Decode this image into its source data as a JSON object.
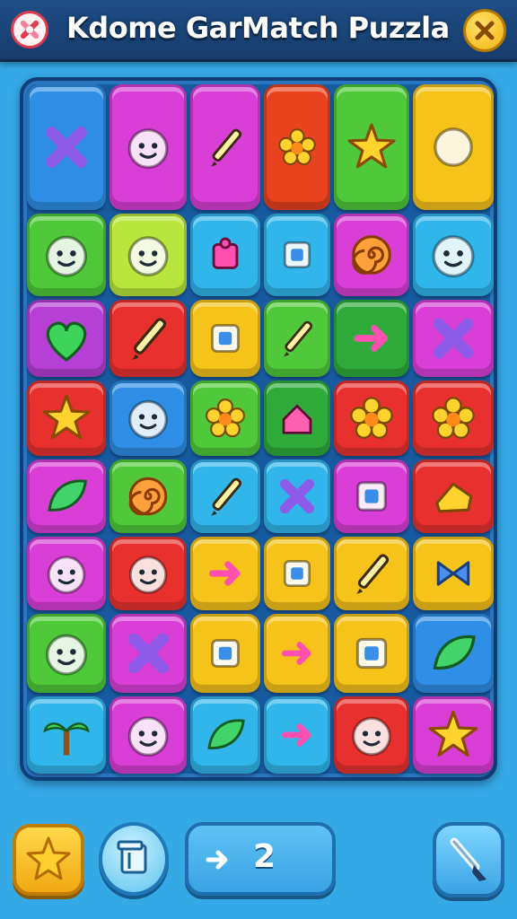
{
  "header": {
    "title": "Kdome GarMatch Puzzla",
    "logo_icon": "crossed-tools-icon",
    "close_icon": "close-x-icon"
  },
  "colors": {
    "header": "#1f4e86",
    "background": "#35a8e6",
    "board": "#185aa0",
    "accent_yellow": "#f6c31b"
  },
  "board": {
    "rows": 8,
    "cols": 6,
    "tiles": [
      [
        {
          "color": "#2f8fe6",
          "icon": "crossed-tools-and-panel-icon"
        },
        {
          "color": "#d93fd6",
          "icon": "cheese-and-bear-face-icon"
        },
        {
          "color": "#d93fd6",
          "icon": "pencil-and-guitar-icon"
        },
        {
          "color": "#e8421f",
          "icon": "gear-and-tower-icon"
        },
        {
          "color": "#4fc93a",
          "icon": "cloud-and-star-icon"
        },
        {
          "color": "#f6c31b",
          "icon": "swirl-and-bandage-icon"
        }
      ],
      [
        {
          "color": "#4fc93a",
          "icon": "koala-face-icon"
        },
        {
          "color": "#b9e63c",
          "icon": "blob-with-hat-icon"
        },
        {
          "color": "#31b6ec",
          "icon": "puzzle-piece-icon"
        },
        {
          "color": "#31b6ec",
          "icon": "bottle-icon"
        },
        {
          "color": "#d93fd6",
          "icon": "spiral-icon"
        },
        {
          "color": "#31b6ec",
          "icon": "lion-face-icon"
        }
      ],
      [
        {
          "color": "#b63fd6",
          "icon": "heart-icon"
        },
        {
          "color": "#e8312f",
          "icon": "tube-icon"
        },
        {
          "color": "#f6c31b",
          "icon": "smiling-square-icon"
        },
        {
          "color": "#4fc93a",
          "icon": "brush-icon"
        },
        {
          "color": "#2eab3a",
          "icon": "music-note-icon"
        },
        {
          "color": "#d93fd6",
          "icon": "cross-icon"
        }
      ],
      [
        {
          "color": "#e8312f",
          "icon": "blob-star-icon"
        },
        {
          "color": "#2f8fe6",
          "icon": "smiling-ball-icon"
        },
        {
          "color": "#4fc93a",
          "icon": "flower-icon"
        },
        {
          "color": "#2eab3a",
          "icon": "house-icon"
        },
        {
          "color": "#e8312f",
          "icon": "splash-icon"
        },
        {
          "color": "#e8312f",
          "icon": "smiling-flower-icon"
        }
      ],
      [
        {
          "color": "#d93fd6",
          "icon": "leaf-icon"
        },
        {
          "color": "#4fc93a",
          "icon": "spiral-icon"
        },
        {
          "color": "#31b6ec",
          "icon": "paintbrush-icon"
        },
        {
          "color": "#31b6ec",
          "icon": "cross-icon"
        },
        {
          "color": "#d93fd6",
          "icon": "letter-cube-icon"
        },
        {
          "color": "#e8312f",
          "icon": "cheese-icon"
        }
      ],
      [
        {
          "color": "#d93fd6",
          "icon": "bear-face-icon"
        },
        {
          "color": "#e8312f",
          "icon": "cat-face-icon"
        },
        {
          "color": "#f6c31b",
          "icon": "bow-and-arrow-icon"
        },
        {
          "color": "#f6c31b",
          "icon": "note-card-icon"
        },
        {
          "color": "#f6c31b",
          "icon": "pencil-icon"
        },
        {
          "color": "#f6c31b",
          "icon": "bow-tie-icon"
        }
      ],
      [
        {
          "color": "#4fc93a",
          "icon": "slime-face-icon"
        },
        {
          "color": "#d93fd6",
          "icon": "cross-icon"
        },
        {
          "color": "#f6c31b",
          "icon": "camera-icon"
        },
        {
          "color": "#f6c31b",
          "icon": "hook-icon"
        },
        {
          "color": "#f6c31b",
          "icon": "checkbox-icon"
        },
        {
          "color": "#2f8fe6",
          "icon": "leaf-icon"
        }
      ],
      [
        {
          "color": "#31b6ec",
          "icon": "palm-tree-icon"
        },
        {
          "color": "#d93fd6",
          "icon": "critter-face-icon"
        },
        {
          "color": "#31b6ec",
          "icon": "leaf-icon"
        },
        {
          "color": "#31b6ec",
          "icon": "arrow-icon"
        },
        {
          "color": "#e8312f",
          "icon": "blob-icon"
        },
        {
          "color": "#d93fd6",
          "icon": "star-flower-icon"
        }
      ]
    ]
  },
  "footer": {
    "star_button_icon": "star-icon",
    "card_button_icon": "card-icon",
    "counter_icon": "plus-arrow-icon",
    "counter_value": "2",
    "brush_button_icon": "brush-icon"
  }
}
